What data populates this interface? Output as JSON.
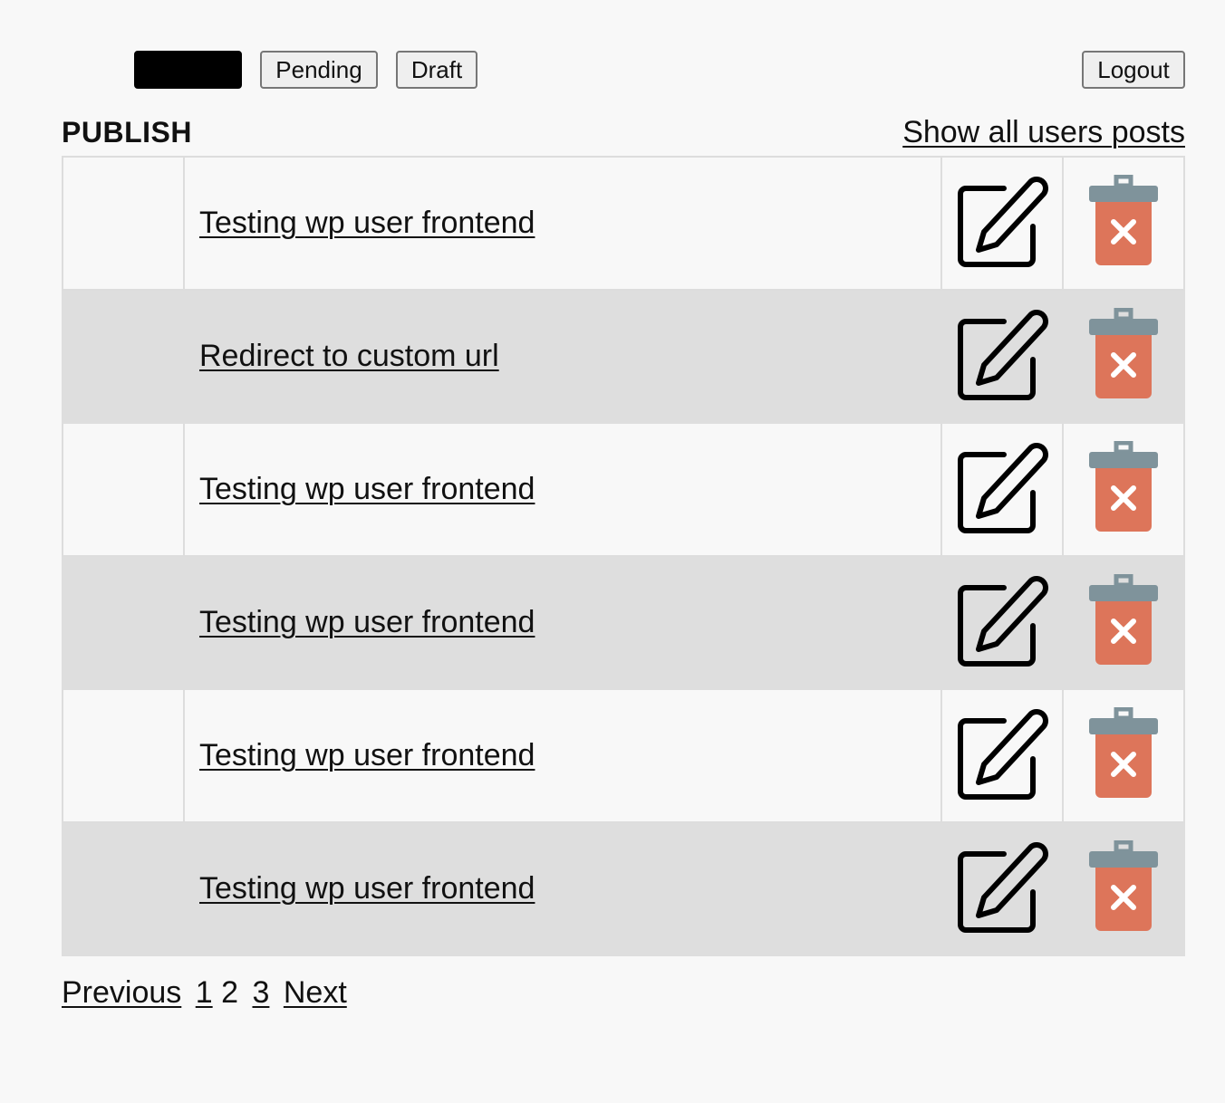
{
  "toolbar": {
    "publish_label": "",
    "pending_label": "Pending",
    "draft_label": "Draft",
    "logout_label": "Logout"
  },
  "section": {
    "title": "PUBLISH",
    "show_all_link": "Show all users posts"
  },
  "posts": [
    {
      "title": "Testing wp user frontend"
    },
    {
      "title": "Redirect to custom url"
    },
    {
      "title": "Testing wp user frontend"
    },
    {
      "title": "Testing wp user frontend"
    },
    {
      "title": "Testing wp user frontend"
    },
    {
      "title": "Testing wp user frontend"
    }
  ],
  "icons": {
    "edit": "edit-icon",
    "delete": "trash-delete-icon"
  },
  "colors": {
    "trash_lid": "#7f939b",
    "trash_body": "#dd755a",
    "row_alt": "#dedede",
    "page_bg": "#f8f8f8"
  },
  "pagination": {
    "previous_label": "Previous",
    "pages": [
      "1",
      "2",
      "3"
    ],
    "current_page": "2",
    "next_label": "Next"
  }
}
